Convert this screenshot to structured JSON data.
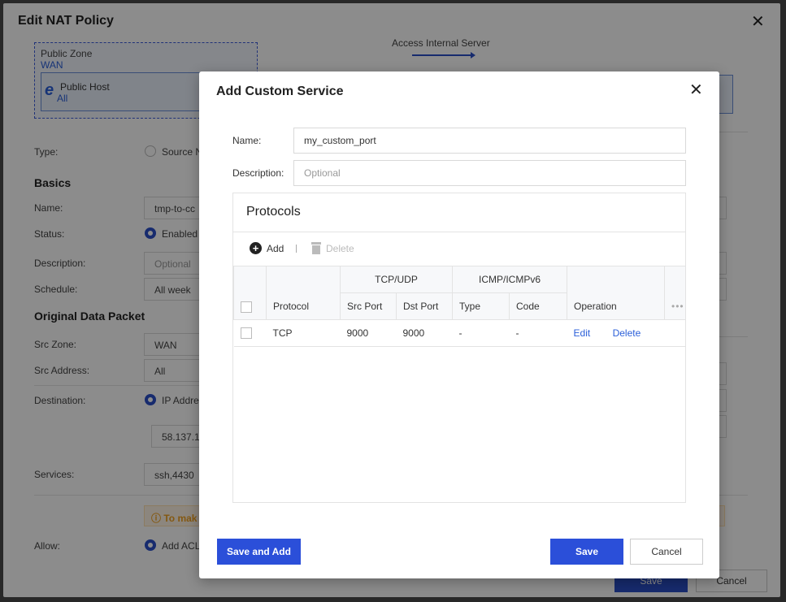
{
  "background": {
    "title": "Edit NAT Policy",
    "zone": {
      "label": "Public Zone",
      "value": "WAN"
    },
    "host": {
      "label": "Public Host",
      "value": "All"
    },
    "access_label": "Access Internal Server",
    "type": {
      "label": "Type:",
      "option": "Source N"
    },
    "basics_heading": "Basics",
    "name": {
      "label": "Name:",
      "value": "tmp-to-cc"
    },
    "status": {
      "label": "Status:",
      "option": "Enabled"
    },
    "description": {
      "label": "Description:",
      "placeholder": "Optional"
    },
    "schedule": {
      "label": "Schedule:",
      "value": "All week"
    },
    "original_heading": "Original Data Packet",
    "src_zone": {
      "label": "Src Zone:",
      "value": "WAN"
    },
    "src_address": {
      "label": "Src Address:",
      "value": "All"
    },
    "destination": {
      "label": "Destination:",
      "option": "IP Addre",
      "value": "58.137.1"
    },
    "services": {
      "label": "Services:",
      "value": "ssh,4430"
    },
    "warning": "To mak",
    "allow": {
      "label": "Allow:",
      "option": "Add ACL"
    },
    "save_label": "Save",
    "cancel_label": "Cancel"
  },
  "modal": {
    "title": "Add Custom Service",
    "name_label": "Name:",
    "name_value": "my_custom_port",
    "description_label": "Description:",
    "description_placeholder": "Optional",
    "protocols": {
      "title": "Protocols",
      "add_label": "Add",
      "delete_label": "Delete",
      "headers": {
        "protocol": "Protocol",
        "tcp_udp": "TCP/UDP",
        "src_port": "Src Port",
        "dst_port": "Dst Port",
        "icmp": "ICMP/ICMPv6",
        "type": "Type",
        "code": "Code",
        "operation": "Operation",
        "more": "•••"
      },
      "rows": [
        {
          "protocol": "TCP",
          "src_port": "9000",
          "dst_port": "9000",
          "type": "-",
          "code": "-",
          "edit": "Edit",
          "delete": "Delete"
        }
      ]
    },
    "buttons": {
      "save_and_add": "Save and Add",
      "save": "Save",
      "cancel": "Cancel"
    }
  }
}
